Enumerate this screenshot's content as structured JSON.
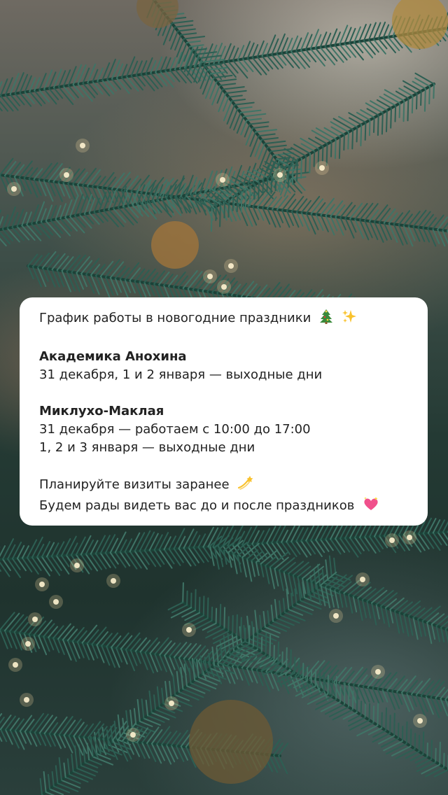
{
  "story": {
    "title": "График работы в новогодние праздники",
    "title_emojis": [
      "christmas-tree-icon",
      "sparkles-icon"
    ],
    "locations": [
      {
        "name": "Академика Анохина",
        "lines": [
          "31 декабря, 1 и 2 января — выходные дни"
        ]
      },
      {
        "name": "Миклухо-Маклая",
        "lines": [
          "31 декабря — работаем с 10:00 до 17:00",
          "1, 2 и 3 января — выходные дни"
        ]
      }
    ],
    "closing": {
      "line1": "Планируйте визиты заранее",
      "line1_emoji": "shooting-star-icon",
      "line2": "Будем рады видеть вас до и после праздников",
      "line2_emoji": "sparkling-heart-icon"
    }
  },
  "colors": {
    "card_background": "#ffffff",
    "text": "#222222",
    "fir_green": "#1f4a41",
    "bokeh_gold": "#f4d9a0"
  }
}
